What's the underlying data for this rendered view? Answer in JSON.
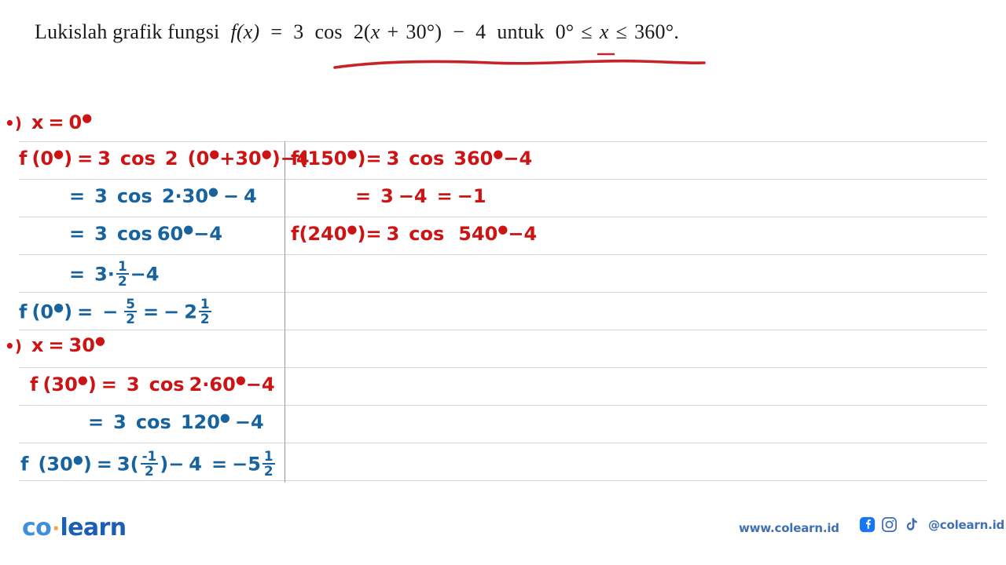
{
  "question": {
    "lead": "Lukislah grafik fungsi",
    "fn": "f(x)",
    "eq": "=",
    "coef": "3",
    "cos": "cos",
    "arg_open": "2(",
    "var": "x",
    "plus": "+",
    "thirty": "30",
    "deg1": "°",
    "arg_close": ")",
    "minus": "−",
    "four": "4",
    "untuk": "untuk",
    "lower": "0°",
    "le1": "≤",
    "varx": "x",
    "le2": "≤",
    "upper": "360°",
    "period": ".",
    "full_text": "Lukislah grafik fungsi f(x) = 3 cos 2(x + 30°) − 4 untuk 0° ≤ x ≤ 360°."
  },
  "colors": {
    "red_ink": "#cc1414",
    "blue_ink": "#17639f",
    "gridline": "#d9d9d9",
    "divider": "#9a9a9a",
    "logo_co": "#3f8fdc",
    "logo_dot": "#f2a33c",
    "logo_learn": "#1a5fb4",
    "footer_text": "#3f6fb5",
    "facebook": "#1877f2"
  },
  "solution": {
    "left_column": [
      {
        "id": "bullet-x-0",
        "ink": "red",
        "role": "case-heading",
        "text": "•) x = 0°"
      },
      {
        "id": "f-0-line1",
        "ink": "red",
        "role": "equation",
        "text": "f(0°)= 3 cos 2 (0°+30°) − 4"
      },
      {
        "id": "f-0-line2",
        "ink": "blue",
        "role": "equation",
        "text": "= 3 cos 2·30° − 4"
      },
      {
        "id": "f-0-line3",
        "ink": "blue",
        "role": "equation",
        "text": "= 3 cos 60° − 4"
      },
      {
        "id": "f-0-line4",
        "ink": "blue",
        "role": "equation",
        "text": "= 3 · 1/2 − 4"
      },
      {
        "id": "f-0-result",
        "ink": "blue",
        "role": "result",
        "text": "f(0°) = − 5/2 = − 2 1/2"
      },
      {
        "id": "bullet-x-30",
        "ink": "red",
        "role": "case-heading",
        "text": "•) x = 30°"
      },
      {
        "id": "f-30-line1",
        "ink": "red",
        "role": "equation",
        "text": "f(30°) = 3 cos 2·60° − 4"
      },
      {
        "id": "f-30-line2",
        "ink": "blue",
        "role": "equation",
        "text": "= 3 cos 120° − 4"
      },
      {
        "id": "f-30-result",
        "ink": "blue",
        "role": "result",
        "text": "f (30°) = 3(-1/2) − 4 = − 5 1/2"
      }
    ],
    "right_column": [
      {
        "id": "f-150-line1",
        "ink": "red",
        "role": "equation",
        "text": "f(150°)= 3 cos 360° − 4"
      },
      {
        "id": "f-150-result",
        "ink": "red",
        "role": "result",
        "text": "= 3 − 4 = −1"
      },
      {
        "id": "f-240-line1",
        "ink": "red",
        "role": "equation",
        "text": "f(240°)= 3 cos  540° − 4"
      }
    ]
  },
  "footer": {
    "logo_co": "co",
    "logo_dot": "·",
    "logo_learn": "learn",
    "website": "www.colearn.id",
    "handle": "@colearn.id",
    "icons": [
      "facebook-icon",
      "instagram-icon",
      "tiktok-icon"
    ]
  }
}
